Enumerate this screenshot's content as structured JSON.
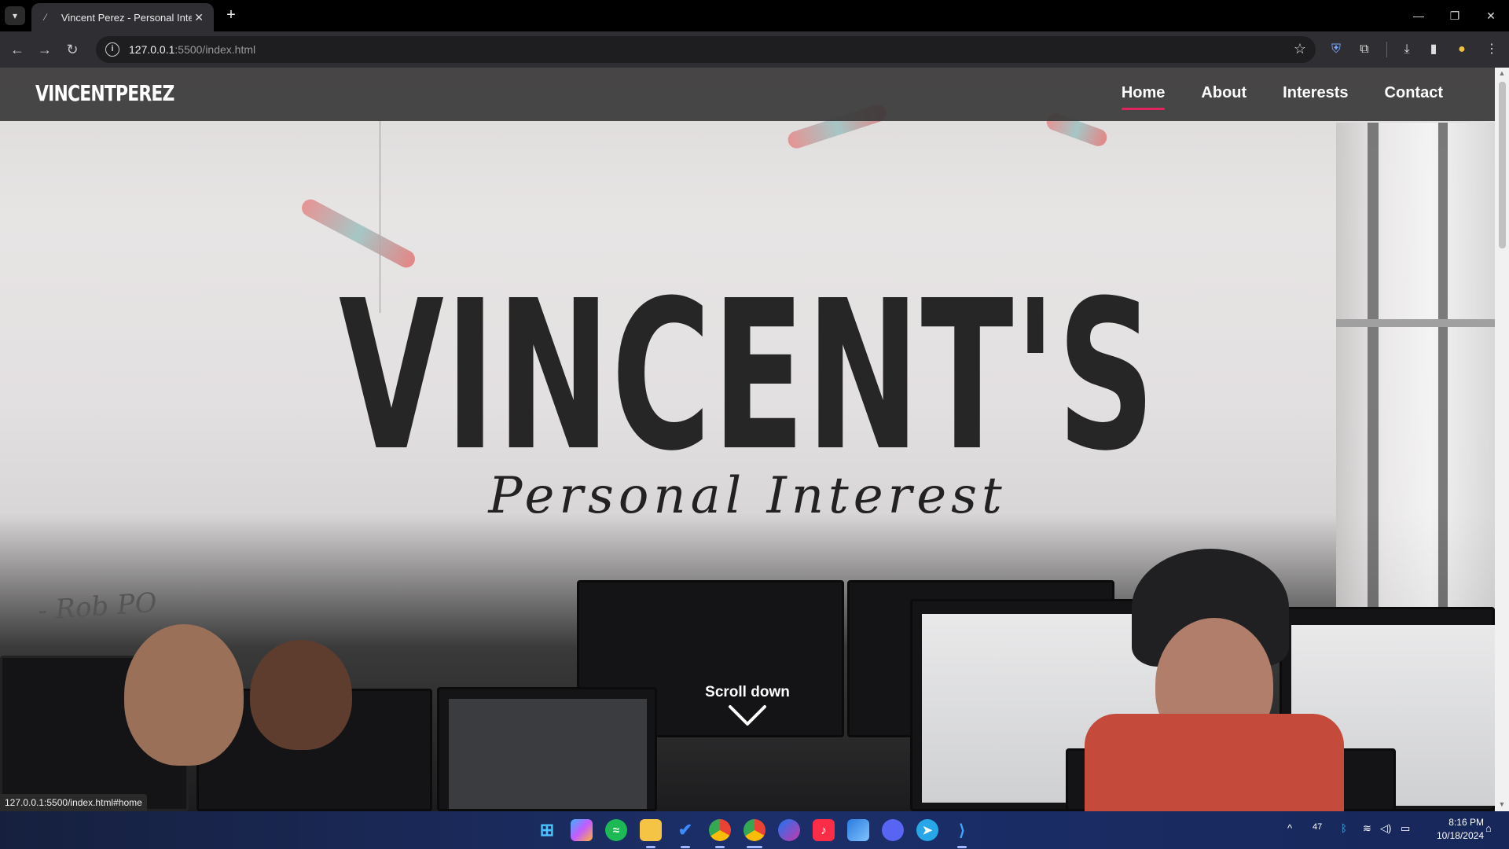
{
  "browser": {
    "tab_title": "Vincent Perez - Personal Interests",
    "url_host": "127.0.0.1",
    "url_path": ":5500/index.html",
    "new_tab_symbol": "+",
    "status_url": "127.0.0.1:5500/index.html#home"
  },
  "site": {
    "logo": "VINCENTPEREZ",
    "nav": [
      {
        "label": "Home",
        "active": true
      },
      {
        "label": "About",
        "active": false
      },
      {
        "label": "Interests",
        "active": false
      },
      {
        "label": "Contact",
        "active": false
      }
    ],
    "accent_color": "#e0245e"
  },
  "hero": {
    "title": "VINCENT'S",
    "subtitle": "Personal Interest",
    "scroll_label": "Scroll down",
    "whiteboard_note": "- Rob PO"
  },
  "taskbar": {
    "apps": [
      "windows-start-icon",
      "copilot-icon",
      "spotify-icon",
      "file-explorer-icon",
      "todo-icon",
      "chrome-icon",
      "chrome-profile-icon",
      "messenger-icon",
      "music-icon",
      "photos-icon",
      "discord-icon",
      "telegram-icon",
      "vscode-icon"
    ],
    "tray_temp": "47",
    "time": "8:16 PM",
    "date": "10/18/2024"
  }
}
